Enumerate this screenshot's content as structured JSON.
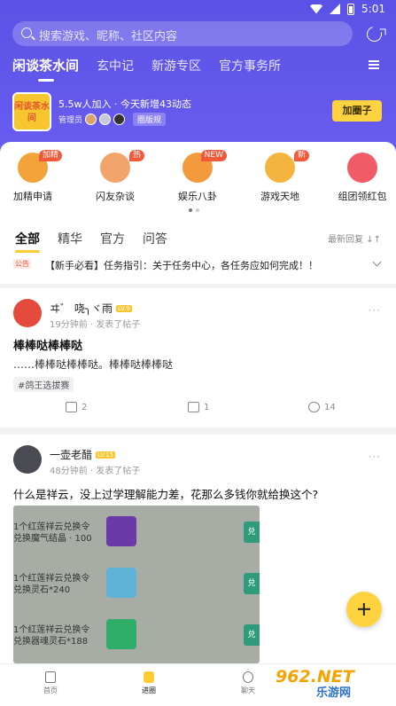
{
  "status": {
    "time": "5:01"
  },
  "search": {
    "placeholder": "搜索游戏、昵称、社区内容"
  },
  "topnav": {
    "tabs": [
      "闲谈茶水间",
      "玄中记",
      "新游专区",
      "官方事务所"
    ]
  },
  "circle": {
    "logo_text": "闲谈茶水间",
    "stats": "5.5w人加入 · 今天新增43动态",
    "admin_label": "管理员",
    "rules_label": "圈版规",
    "join_label": "加圈子"
  },
  "categories": [
    {
      "label": "加精申请",
      "badge": "加精",
      "color": "#f2a33a"
    },
    {
      "label": "闪友杂谈",
      "badge": "热",
      "color": "#f2a56b"
    },
    {
      "label": "娱乐八卦",
      "badge": "NEW",
      "color": "#f39a3c"
    },
    {
      "label": "游戏天地",
      "badge": "新",
      "color": "#f4b43d"
    },
    {
      "label": "组团领红包",
      "badge": "",
      "color": "#ef5b66"
    }
  ],
  "feed_tabs": [
    "全部",
    "精华",
    "官方",
    "问答"
  ],
  "sort_label": "最新回复",
  "notice": {
    "tag": "公告",
    "text": "【新手必看】任务指引：关于任务中心，各任务应如何完成！！"
  },
  "posts": [
    {
      "author": "ヰ゛ 哓╮ヾ雨",
      "level": "LV.9",
      "meta": "19分钟前 · 发表了帖子",
      "title": "棒棒哒棒棒哒",
      "body": "……棒棒哒棒棒哒。棒棒哒棒棒哒",
      "topic": "#鸽王选拔赛",
      "shares": "2",
      "comments": "1",
      "likes": "14"
    },
    {
      "author": "一壶老醋",
      "level": "LV.15",
      "meta": "48分钟前 · 发表了帖子",
      "text": "什么是祥云，没上过学理解能力差，花那么多钱你就给换这个?",
      "image_rows": [
        {
          "text1": "1个红莲祥云兑换令",
          "text2": "兑换魔气结晶 · 100",
          "gem_color": "#6a3aa8"
        },
        {
          "text1": "1个红莲祥云兑换令",
          "text2": "兑换灵石*240",
          "gem_color": "#5fb3d6"
        },
        {
          "text1": "1个红莲祥云兑换令",
          "text2": "兑换器魂灵石*188",
          "gem_color": "#2fae6a"
        }
      ],
      "image_button": "兑"
    }
  ],
  "bottomnav": {
    "items": [
      "首页",
      "进圈",
      "聊天"
    ]
  },
  "watermark": {
    "top": "962.NET",
    "sub": "乐游网"
  }
}
